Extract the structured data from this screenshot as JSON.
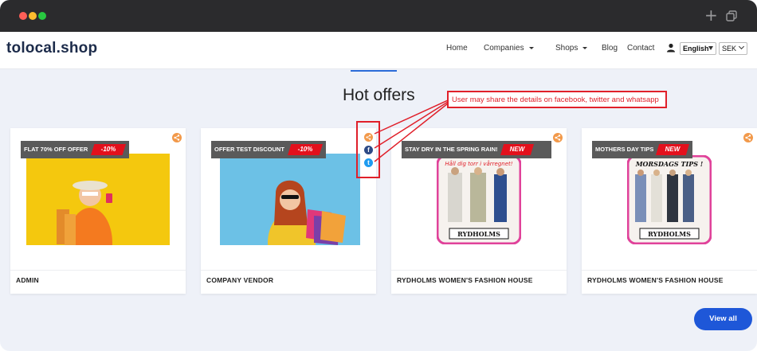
{
  "browser": {
    "plus_glyph": "+"
  },
  "navbar": {
    "logo": "tolocal.shop",
    "items": [
      {
        "label": "Home",
        "dropdown": false
      },
      {
        "label": "Companies",
        "dropdown": true
      },
      {
        "label": "Shops",
        "dropdown": true
      },
      {
        "label": "Blog",
        "dropdown": false
      },
      {
        "label": "Contact",
        "dropdown": false
      }
    ],
    "language": "English",
    "currency": "SEK",
    "icons": [
      "user-icon"
    ]
  },
  "section": {
    "title": "Hot offers"
  },
  "annotation": {
    "text": "User may share the details on facebook, twitter and whatsapp"
  },
  "share_popup": {
    "facebook_glyph": "f",
    "twitter_glyph": "t"
  },
  "cards": [
    {
      "badge": "FLAT 70% OFF OFFER",
      "tag": "-10%",
      "name": "ADMIN"
    },
    {
      "badge": "OFFER TEST DISCOUNT",
      "tag": "-10%",
      "name": "COMPANY VENDOR"
    },
    {
      "badge": "STAY DRY IN THE SPRING RAIN!",
      "tag": "NEW",
      "name": "RYDHOLMS WOMEN'S FASHION HOUSE",
      "poster_headline": "Håll dig torr i vårregnet!",
      "poster_brand": "RYDHOLMS"
    },
    {
      "badge": "MOTHERS DAY TIPS",
      "tag": "NEW",
      "name": "RYDHOLMS WOMEN'S FASHION HOUSE",
      "poster_headline": "MORSDAGS TIPS !",
      "poster_brand": "RYDHOLMS"
    }
  ],
  "buttons": {
    "view_all": "View all"
  },
  "colors": {
    "accent": "#1e57d8",
    "badge_tag": "#e3101c",
    "share": "#f2994a",
    "annotation": "#e0202a",
    "poster_border": "#e0429a"
  }
}
